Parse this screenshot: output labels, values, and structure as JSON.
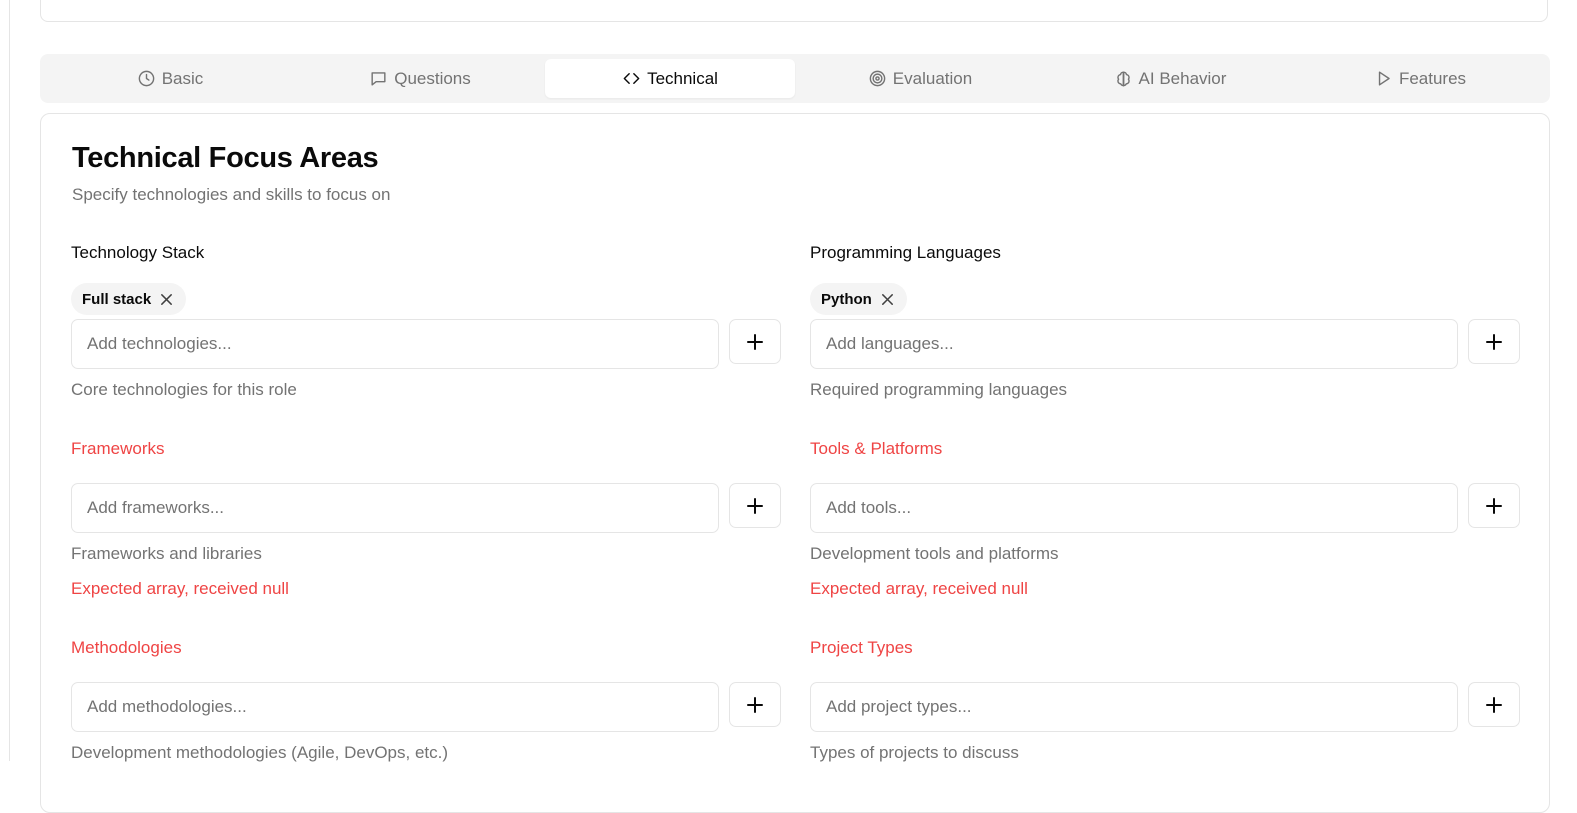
{
  "tabs": [
    {
      "label": "Basic",
      "icon": "clock-icon",
      "active": false
    },
    {
      "label": "Questions",
      "icon": "message-square-icon",
      "active": false
    },
    {
      "label": "Technical",
      "icon": "code-icon",
      "active": true
    },
    {
      "label": "Evaluation",
      "icon": "target-icon",
      "active": false
    },
    {
      "label": "AI Behavior",
      "icon": "brain-icon",
      "active": false
    },
    {
      "label": "Features",
      "icon": "play-icon",
      "active": false
    }
  ],
  "card": {
    "title": "Technical Focus Areas",
    "subtitle": "Specify technologies and skills to focus on"
  },
  "fields": {
    "technology_stack": {
      "label": "Technology Stack",
      "tags": [
        "Full stack"
      ],
      "placeholder": "Add technologies...",
      "help": "Core technologies for this role"
    },
    "programming_languages": {
      "label": "Programming Languages",
      "tags": [
        "Python"
      ],
      "placeholder": "Add languages...",
      "help": "Required programming languages"
    },
    "frameworks": {
      "label": "Frameworks",
      "placeholder": "Add frameworks...",
      "help": "Frameworks and libraries",
      "error": "Expected array, received null"
    },
    "tools_platforms": {
      "label": "Tools & Platforms",
      "placeholder": "Add tools...",
      "help": "Development tools and platforms",
      "error": "Expected array, received null"
    },
    "methodologies": {
      "label": "Methodologies",
      "placeholder": "Add methodologies...",
      "help": "Development methodologies (Agile, DevOps, etc.)"
    },
    "project_types": {
      "label": "Project Types",
      "placeholder": "Add project types...",
      "help": "Types of projects to discuss"
    }
  },
  "colors": {
    "error": "#ef4444",
    "muted": "#737373",
    "border": "#e5e5e5",
    "tab_bg": "#f4f4f4"
  }
}
